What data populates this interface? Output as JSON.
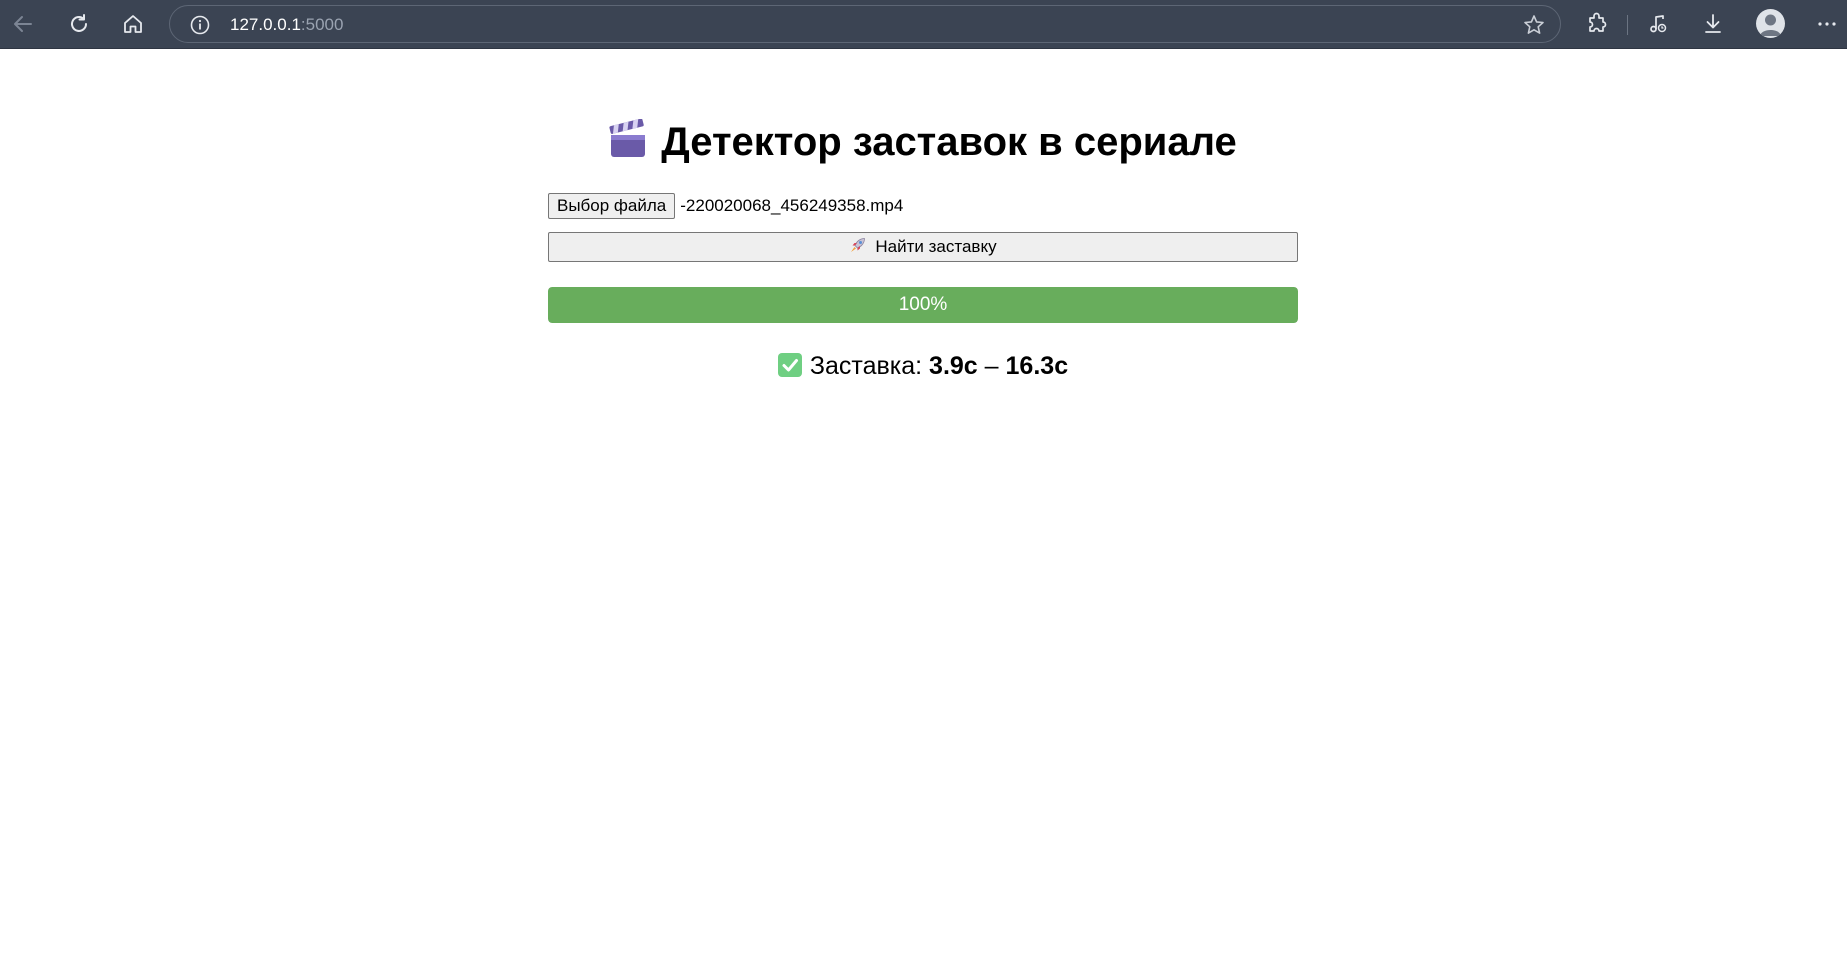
{
  "browser": {
    "url_host": "127.0.0.1",
    "url_port": ":5000",
    "icons": [
      "back-icon",
      "reload-icon",
      "home-icon",
      "info-icon",
      "star-icon",
      "extensions-icon",
      "media-icon",
      "download-icon",
      "profile-avatar",
      "more-icon"
    ],
    "colors": {
      "toolbar": "#3b4453"
    }
  },
  "page": {
    "title": "Детектор заставок в сериале",
    "title_icon": "clapper-board-icon",
    "file_button_label": "Выбор файла",
    "file_name": "-220020068_456249358.mp4",
    "find_button_label": "Найти заставку",
    "find_button_icon": "rocket-icon",
    "progress": {
      "value_percent": 100,
      "label": "100%",
      "color": "#68ad5c"
    },
    "result": {
      "icon": "check-mark-icon",
      "label": "Заставка:",
      "start": "3.9с",
      "separator": "–",
      "end": "16.3с"
    }
  }
}
